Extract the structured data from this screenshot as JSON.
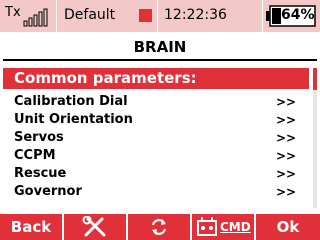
{
  "status_bar": {
    "tx_label": "Tx",
    "signal_level": 1.0,
    "model_name": "Default",
    "time": "12:22:36",
    "battery_percent": "64%",
    "battery_level": 0.64
  },
  "page": {
    "title": "BRAIN"
  },
  "section": {
    "label": "Common parameters:"
  },
  "menu": {
    "items": [
      {
        "label": "Calibration Dial",
        "arrow": ">>"
      },
      {
        "label": "Unit Orientation",
        "arrow": ">>"
      },
      {
        "label": "Servos",
        "arrow": ">>"
      },
      {
        "label": "CCPM",
        "arrow": ">>"
      },
      {
        "label": "Rescue",
        "arrow": ">>"
      },
      {
        "label": "Governor",
        "arrow": ">>"
      }
    ]
  },
  "bottom_bar": {
    "back_label": "Back",
    "tools_icon": "wrench-screwdriver-icon",
    "refresh_icon": "refresh-icon",
    "cmd_label": "CMD",
    "cmd_icon": "radio-cmd-icon",
    "ok_label": "Ok"
  },
  "colors": {
    "accent_red": "#e0303a",
    "status_bar_bg": "#f2c8c8"
  }
}
